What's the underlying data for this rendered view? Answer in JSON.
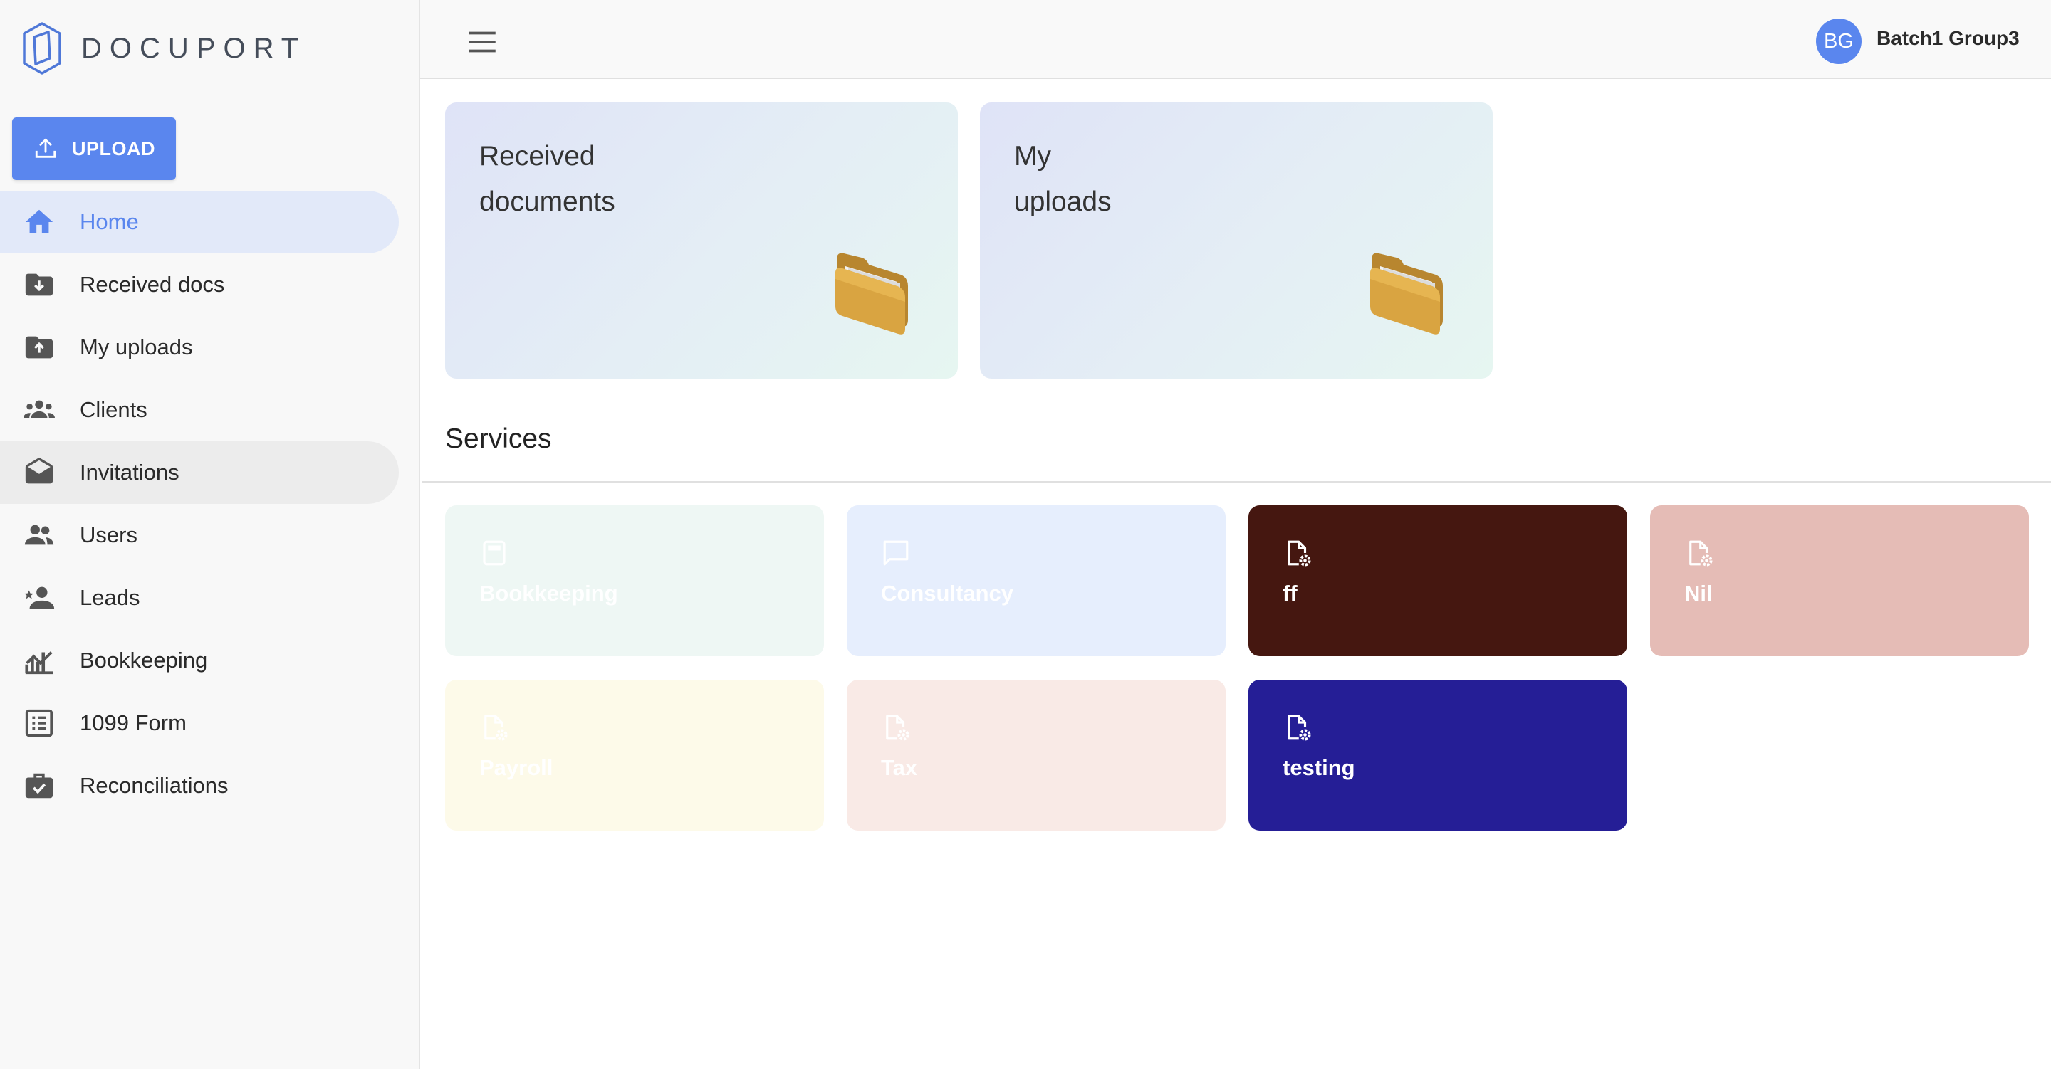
{
  "app": {
    "logo_text": "DOCUPORT"
  },
  "sidebar": {
    "upload_label": "UPLOAD",
    "items": [
      {
        "label": "Home",
        "icon": "home-icon",
        "active": true
      },
      {
        "label": "Received docs",
        "icon": "folder-download-icon"
      },
      {
        "label": "My uploads",
        "icon": "folder-upload-icon"
      },
      {
        "label": "Clients",
        "icon": "groups-icon"
      },
      {
        "label": "Invitations",
        "icon": "envelope-open-icon",
        "hover": true
      },
      {
        "label": "Users",
        "icon": "people-icon"
      },
      {
        "label": "Leads",
        "icon": "person-star-icon"
      },
      {
        "label": "Bookkeeping",
        "icon": "chart-icon"
      },
      {
        "label": "1099 Form",
        "icon": "list-form-icon"
      },
      {
        "label": "Reconciliations",
        "icon": "briefcase-check-icon"
      }
    ]
  },
  "header": {
    "avatar_initials": "BG",
    "user_name": "Batch1 Group3"
  },
  "main": {
    "cards": [
      {
        "line1": "Received",
        "line2": "documents",
        "icon": "folder-icon"
      },
      {
        "line1": "My",
        "line2": "uploads",
        "icon": "folder-icon"
      }
    ],
    "services_title": "Services",
    "services": [
      {
        "label": "Bookkeeping",
        "icon": "calculator-icon",
        "color": "#eef7f4"
      },
      {
        "label": "Consultancy",
        "icon": "chat-bubble-icon",
        "color": "#e6eefd"
      },
      {
        "label": "ff",
        "icon": "file-gear-icon",
        "color": "#451710"
      },
      {
        "label": "Nil",
        "icon": "file-gear-icon",
        "color": "#e5bcb6"
      },
      {
        "label": "Payroll",
        "icon": "file-gear-icon",
        "color": "#fdfae9"
      },
      {
        "label": "Tax",
        "icon": "file-gear-icon",
        "color": "#f9eae6"
      },
      {
        "label": "testing",
        "icon": "file-gear-icon",
        "color": "#251e96"
      }
    ]
  }
}
